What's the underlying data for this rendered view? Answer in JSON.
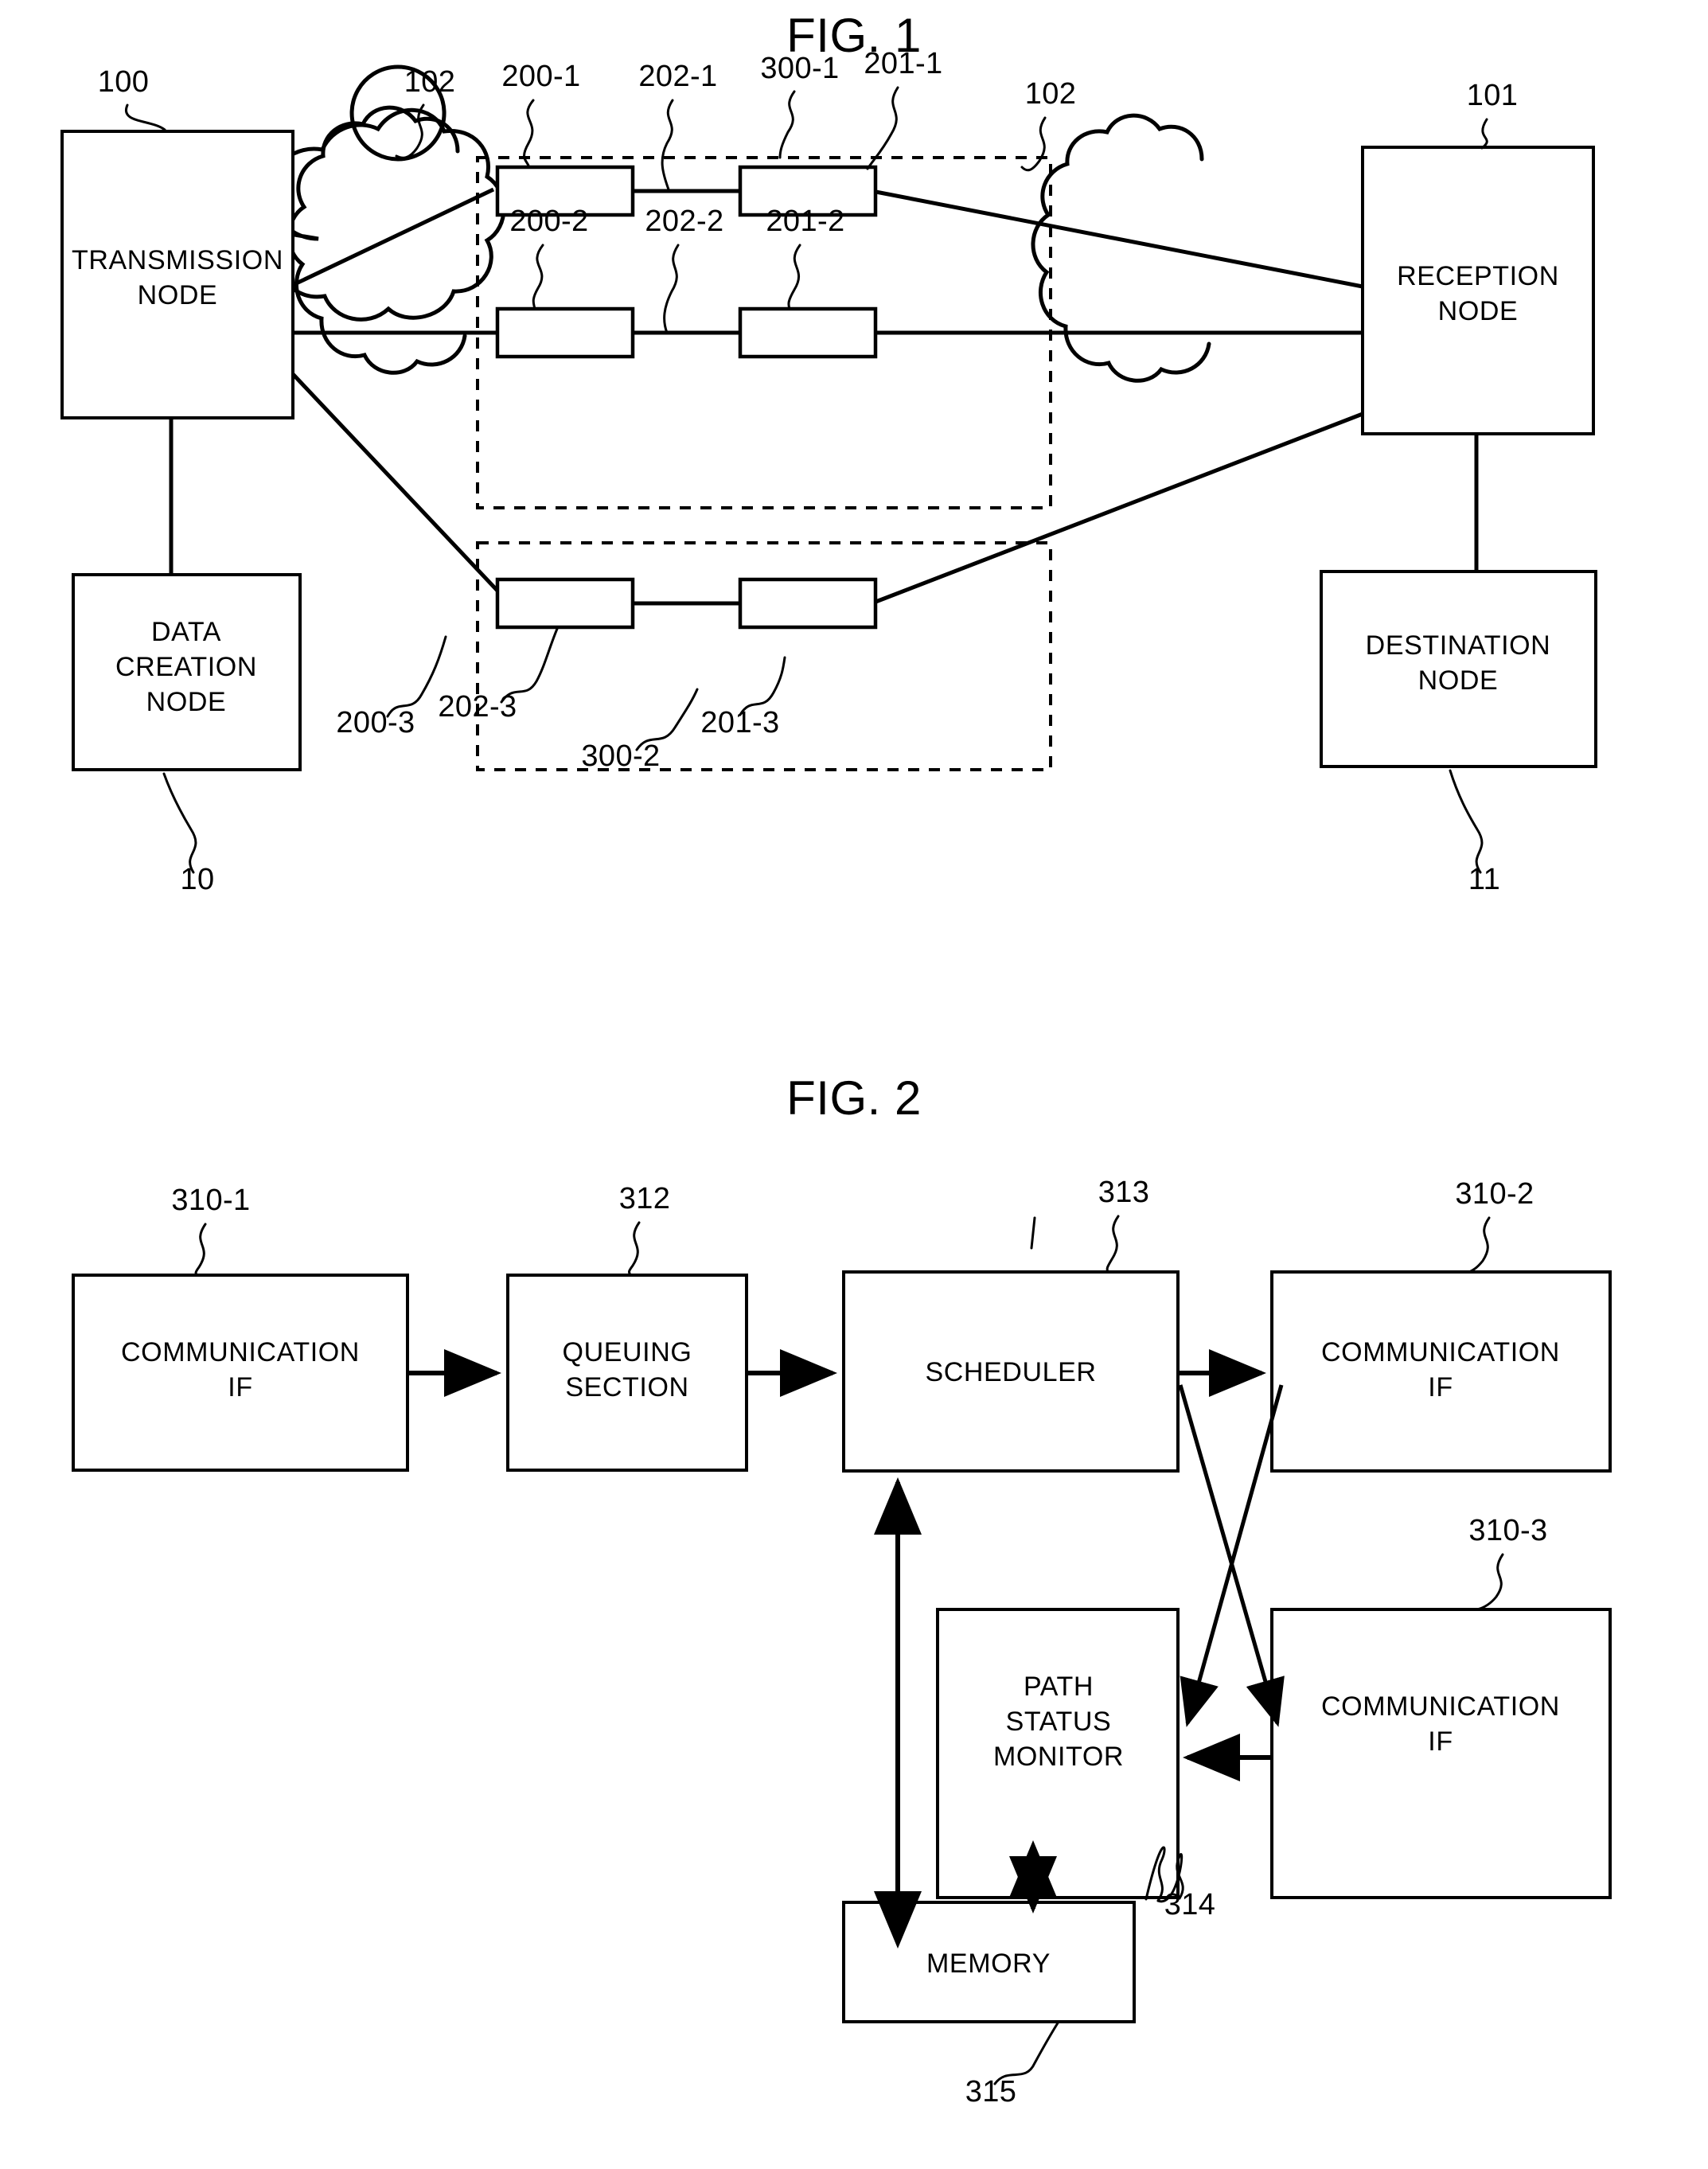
{
  "document": {
    "type": "patent-drawing-sheet",
    "figures": [
      "FIG. 1",
      "FIG. 2"
    ]
  },
  "fig1": {
    "title": "FIG. 1",
    "blocks": {
      "transmission_node": "TRANSMISSION NODE",
      "transmission_node_line1": "TRANSMISSION",
      "transmission_node_line2": "NODE",
      "reception_node_line1": "RECEPTION",
      "reception_node_line2": "NODE",
      "data_creation_node_line1": "DATA",
      "data_creation_node_line2": "CREATION",
      "data_creation_node_line3": "NODE",
      "destination_node_line1": "DESTINATION",
      "destination_node_line2": "NODE"
    },
    "reference_numerals": {
      "transmission_node": "100",
      "reception_node": "101",
      "data_creation_node": "10",
      "destination_node": "11",
      "cloud_left": "102",
      "cloud_right": "102",
      "router_in_1": "200-1",
      "router_in_2": "200-2",
      "router_in_3": "200-3",
      "router_out_1": "201-1",
      "router_out_2": "201-2",
      "router_out_3": "201-3",
      "link_1": "202-1",
      "link_2": "202-2",
      "link_3": "202-3",
      "domain_1": "300-1",
      "domain_2": "300-2"
    }
  },
  "fig2": {
    "title": "FIG. 2",
    "blocks": {
      "comm_if_1_line1": "COMMUNICATION",
      "comm_if_1_line2": "IF",
      "queuing_section_line1": "QUEUING",
      "queuing_section_line2": "SECTION",
      "scheduler": "SCHEDULER",
      "comm_if_2_line1": "COMMUNICATION",
      "comm_if_2_line2": "IF",
      "comm_if_3_line1": "COMMUNICATION",
      "comm_if_3_line2": "IF",
      "path_status_monitor_line1": "PATH",
      "path_status_monitor_line2": "STATUS",
      "path_status_monitor_line3": "MONITOR",
      "memory": "MEMORY"
    },
    "reference_numerals": {
      "comm_if_1": "310-1",
      "queuing_section": "312",
      "scheduler": "313",
      "comm_if_2": "310-2",
      "comm_if_3": "310-3",
      "path_status_monitor": "314",
      "memory": "315"
    }
  },
  "colors": {
    "ink": "#000000",
    "paper": "#ffffff"
  }
}
